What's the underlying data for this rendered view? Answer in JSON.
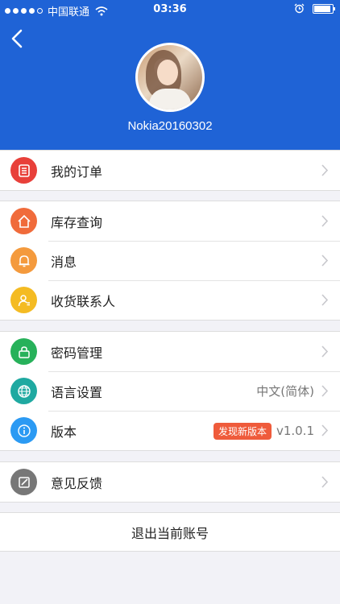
{
  "status": {
    "carrier": "中国联通",
    "time": "03:36",
    "battery_level": 0.9
  },
  "profile": {
    "username": "Nokia20160302"
  },
  "groups": [
    {
      "items": [
        {
          "label": "我的订单",
          "icon": "order-list-icon",
          "color": "#e8403a"
        }
      ]
    },
    {
      "items": [
        {
          "label": "库存查询",
          "icon": "home-icon",
          "color": "#f06b3b"
        },
        {
          "label": "消息",
          "icon": "bell-icon",
          "color": "#f49a3d"
        },
        {
          "label": "收货联系人",
          "icon": "contact-icon",
          "color": "#f4bb23"
        }
      ]
    },
    {
      "items": [
        {
          "label": "密码管理",
          "icon": "lock-icon",
          "color": "#27b15a"
        },
        {
          "label": "语言设置",
          "value": "中文(简体)",
          "icon": "globe-icon",
          "color": "#1fa9a1"
        },
        {
          "label": "版本",
          "badge": "发现新版本",
          "value": "v1.0.1",
          "icon": "info-icon",
          "color": "#2b9af3"
        }
      ]
    },
    {
      "items": [
        {
          "label": "意见反馈",
          "icon": "feedback-icon",
          "color": "#777777"
        }
      ]
    }
  ],
  "logout_label": "退出当前账号",
  "colors": {
    "header": "#1f63d6",
    "background": "#f2f2f7",
    "badge": "#ef5b3b"
  }
}
